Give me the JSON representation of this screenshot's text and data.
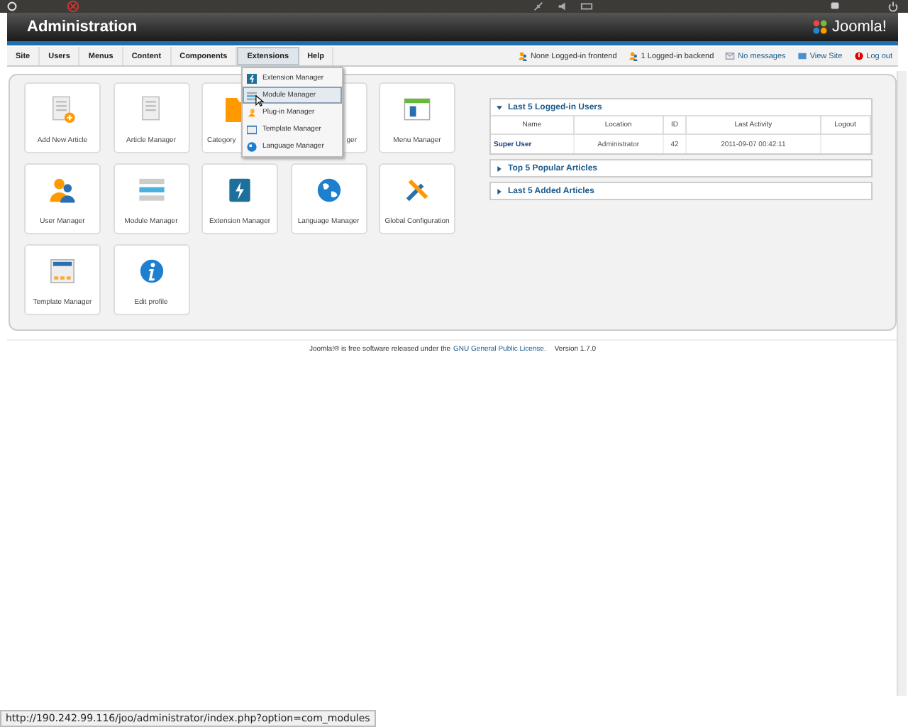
{
  "header": {
    "title": "Administration",
    "logo_text": "Joomla!"
  },
  "menu": [
    {
      "label": "Site",
      "selected": false
    },
    {
      "label": "Users",
      "selected": false
    },
    {
      "label": "Menus",
      "selected": false
    },
    {
      "label": "Content",
      "selected": false
    },
    {
      "label": "Components",
      "selected": false
    },
    {
      "label": "Extensions",
      "selected": true
    },
    {
      "label": "Help",
      "selected": false
    }
  ],
  "status_links": [
    {
      "kind": "frontend",
      "label": "None Logged-in frontend"
    },
    {
      "kind": "backend",
      "label": "1 Logged-in backend"
    },
    {
      "kind": "messages",
      "label": "No messages"
    },
    {
      "kind": "site",
      "label": "View Site"
    },
    {
      "kind": "logout",
      "label": "Log out"
    }
  ],
  "dropdown": [
    {
      "kind": "extension",
      "label": "Extension Manager",
      "selected": false
    },
    {
      "kind": "module",
      "label": "Module Manager",
      "selected": true
    },
    {
      "kind": "plugin",
      "label": "Plug-in Manager",
      "selected": false
    },
    {
      "kind": "template",
      "label": "Template Manager",
      "selected": false
    },
    {
      "kind": "language",
      "label": "Language Manager",
      "selected": false
    }
  ],
  "quick_icons": [
    {
      "kind": "add-article",
      "label": "Add New Article"
    },
    {
      "kind": "article",
      "label": "Article Manager"
    },
    {
      "kind": "category",
      "label": "Category",
      "cut_end": true
    },
    {
      "kind": "none",
      "label": "ger",
      "cut_start": true
    },
    {
      "kind": "menu",
      "label": "Menu Manager"
    },
    {
      "kind": "user",
      "label": "User Manager"
    },
    {
      "kind": "module",
      "label": "Module Manager"
    },
    {
      "kind": "extension",
      "label": "Extension Manager"
    },
    {
      "kind": "language",
      "label": "Language Manager"
    },
    {
      "kind": "config",
      "label": "Global Configuration"
    },
    {
      "kind": "template",
      "label": "Template Manager"
    },
    {
      "kind": "profile",
      "label": "Edit profile"
    }
  ],
  "panels": [
    {
      "title": "Last 5 Logged-in Users",
      "expanded": true,
      "table": {
        "columns": [
          "Name",
          "Location",
          "ID",
          "Last Activity",
          "Logout"
        ],
        "rows": [
          [
            "Super User",
            "Administrator",
            "42",
            "2011-09-07 00:42:11",
            ""
          ]
        ]
      }
    },
    {
      "title": "Top 5 Popular Articles",
      "expanded": false
    },
    {
      "title": "Last 5 Added Articles",
      "expanded": false
    }
  ],
  "footer": {
    "text": "Joomla!® is free software released under the",
    "link": "GNU General Public License.",
    "version": "Version 1.7.0"
  },
  "status_bar": {
    "url": "http://190.242.99.116/joo/administrator/index.php?option=com_modules"
  }
}
